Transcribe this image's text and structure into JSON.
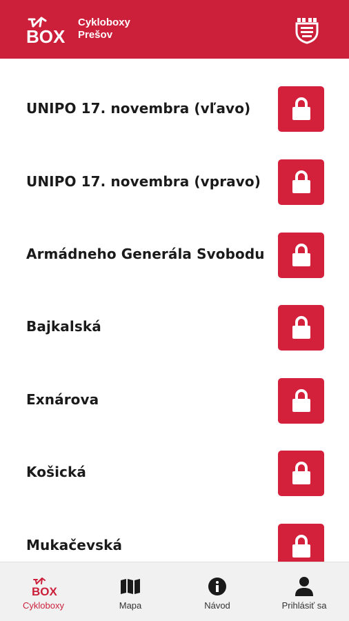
{
  "colors": {
    "brand": "#cc1f3a",
    "button": "#d3203b",
    "text": "#1a1a1a"
  },
  "header": {
    "logo_text": "BOX",
    "title_line1": "Cykloboxy",
    "title_line2": "Prešov",
    "crest_icon": "city-crest-icon"
  },
  "boxes": [
    {
      "name": "UNIPO 17. novembra (vľavo)",
      "icon": "lock-icon"
    },
    {
      "name": "UNIPO 17. novembra (vpravo)",
      "icon": "lock-icon"
    },
    {
      "name": "Armádneho Generála Svobodu",
      "icon": "lock-icon"
    },
    {
      "name": "Bajkalská",
      "icon": "lock-icon"
    },
    {
      "name": "Exnárova",
      "icon": "lock-icon"
    },
    {
      "name": "Košická",
      "icon": "lock-icon"
    },
    {
      "name": "Mukačevská",
      "icon": "lock-icon"
    }
  ],
  "nav": {
    "cykloboxy": "Cykloboxy",
    "mapa": "Mapa",
    "navod": "Návod",
    "prihlasit": "Prihlásiť sa"
  }
}
